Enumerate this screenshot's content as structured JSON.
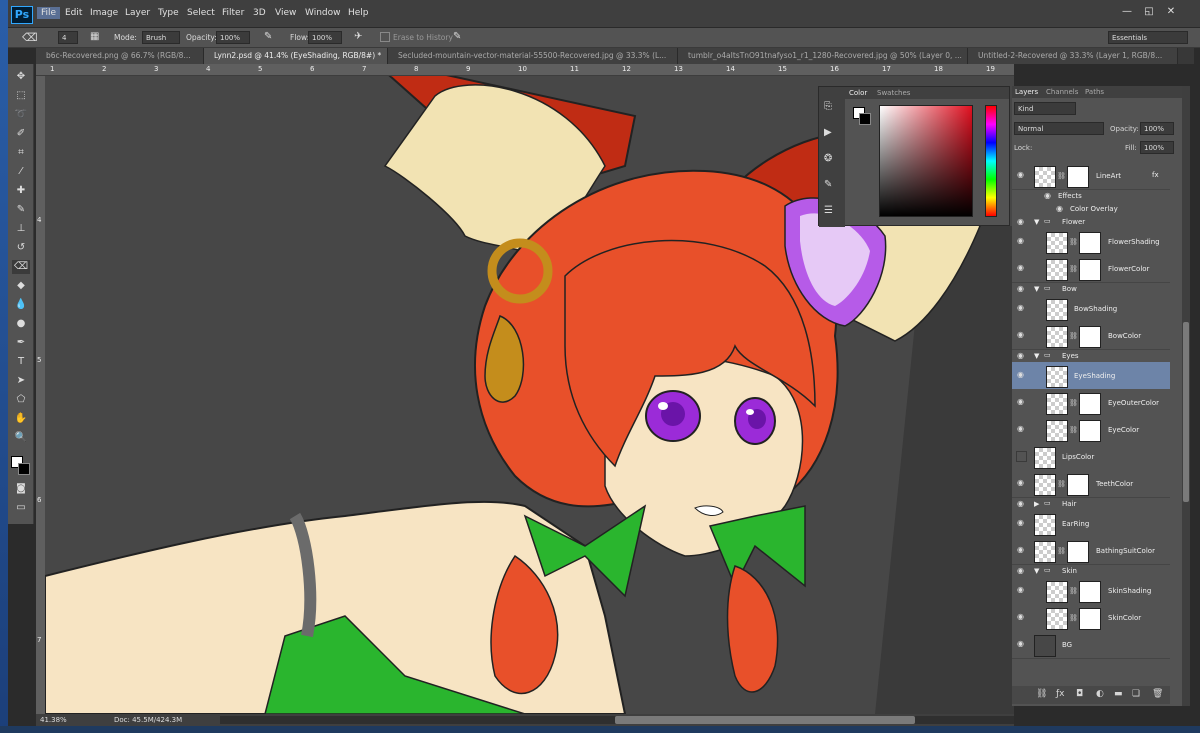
{
  "app": {
    "logo": "Ps"
  },
  "menu": [
    "File",
    "Edit",
    "Image",
    "Layer",
    "Type",
    "Select",
    "Filter",
    "3D",
    "View",
    "Window",
    "Help"
  ],
  "window_buttons": [
    "—",
    "◱",
    "✕"
  ],
  "options": {
    "brush_size": "4",
    "mode_label": "Mode:",
    "mode_value": "Brush",
    "opacity_label": "Opacity:",
    "opacity_value": "100%",
    "flow_label": "Flow:",
    "flow_value": "100%",
    "erase_history": "Erase to History",
    "workspace": "Essentials"
  },
  "tabs": [
    "b6c-Recovered.png @ 66.7% (RGB/8...",
    "Lynn2.psd @ 41.4% (EyeShading, RGB/8#) *",
    "Secluded-mountain-vector-material-55500-Recovered.jpg @ 33.3% (L...",
    "tumblr_o4aItsTnO91tnafyso1_r1_1280-Recovered.jpg @ 50% (Layer 0, ...",
    "Untitled-2-Recovered @ 33.3% (Layer 1, RGB/8..."
  ],
  "ruler_top": [
    "1",
    "2",
    "3",
    "4",
    "5",
    "6",
    "7",
    "8",
    "9",
    "10",
    "11",
    "12",
    "13",
    "14",
    "15",
    "16",
    "17",
    "18",
    "19"
  ],
  "ruler_left": [
    "4",
    "5",
    "6",
    "7"
  ],
  "status": {
    "zoom": "41.38%",
    "doc": "Doc: 45.5M/424.3M"
  },
  "color_panel": {
    "tabs": [
      "Color",
      "Swatches"
    ]
  },
  "layers_panel": {
    "tabs": [
      "Layers",
      "Channels",
      "Paths"
    ],
    "kind": "Kind",
    "blend": "Normal",
    "opacity_label": "Opacity:",
    "opacity_value": "100%",
    "lock_label": "Lock:",
    "fill_label": "Fill:",
    "fill_value": "100%",
    "rows": [
      {
        "type": "layer",
        "name": "LineArt",
        "mask": true,
        "fx": "fx",
        "indent": false,
        "visible": true
      },
      {
        "type": "sub",
        "name": "Effects"
      },
      {
        "type": "sub2",
        "name": "Color Overlay"
      },
      {
        "type": "group",
        "name": "Flower"
      },
      {
        "type": "layer",
        "name": "FlowerShading",
        "mask": true,
        "indent": true,
        "visible": true
      },
      {
        "type": "layer",
        "name": "FlowerColor",
        "mask": true,
        "indent": true,
        "visible": true
      },
      {
        "type": "group",
        "name": "Bow"
      },
      {
        "type": "layer",
        "name": "BowShading",
        "mask": false,
        "indent": true,
        "visible": true
      },
      {
        "type": "layer",
        "name": "BowColor",
        "mask": true,
        "indent": true,
        "visible": true
      },
      {
        "type": "group",
        "name": "Eyes"
      },
      {
        "type": "layer",
        "name": "EyeShading",
        "mask": false,
        "indent": true,
        "visible": true,
        "selected": true
      },
      {
        "type": "layer",
        "name": "EyeOuterColor",
        "mask": true,
        "indent": true,
        "visible": true
      },
      {
        "type": "layer",
        "name": "EyeColor",
        "mask": true,
        "indent": true,
        "visible": true
      },
      {
        "type": "layer",
        "name": "LipsColor",
        "mask": false,
        "indent": false,
        "visible": false
      },
      {
        "type": "layer",
        "name": "TeethColor",
        "mask": true,
        "indent": false,
        "visible": true
      },
      {
        "type": "groupc",
        "name": "Hair"
      },
      {
        "type": "layer",
        "name": "EarRing",
        "mask": false,
        "indent": false,
        "visible": true
      },
      {
        "type": "layer",
        "name": "BathingSuitColor",
        "mask": true,
        "indent": false,
        "visible": true
      },
      {
        "type": "group",
        "name": "Skin"
      },
      {
        "type": "layer",
        "name": "SkinShading",
        "mask": true,
        "indent": true,
        "visible": true
      },
      {
        "type": "layer",
        "name": "SkinColor",
        "mask": true,
        "indent": true,
        "visible": true
      },
      {
        "type": "bg",
        "name": "BG",
        "mask": false,
        "indent": false,
        "visible": true
      }
    ]
  },
  "colors": {
    "hair": "#e8502a",
    "skin": "#f7e4c3",
    "bow": "#2ab52e",
    "eyes": "#9b2bd8",
    "ear": "#f2e3b3",
    "accent": "#5a6f94"
  }
}
